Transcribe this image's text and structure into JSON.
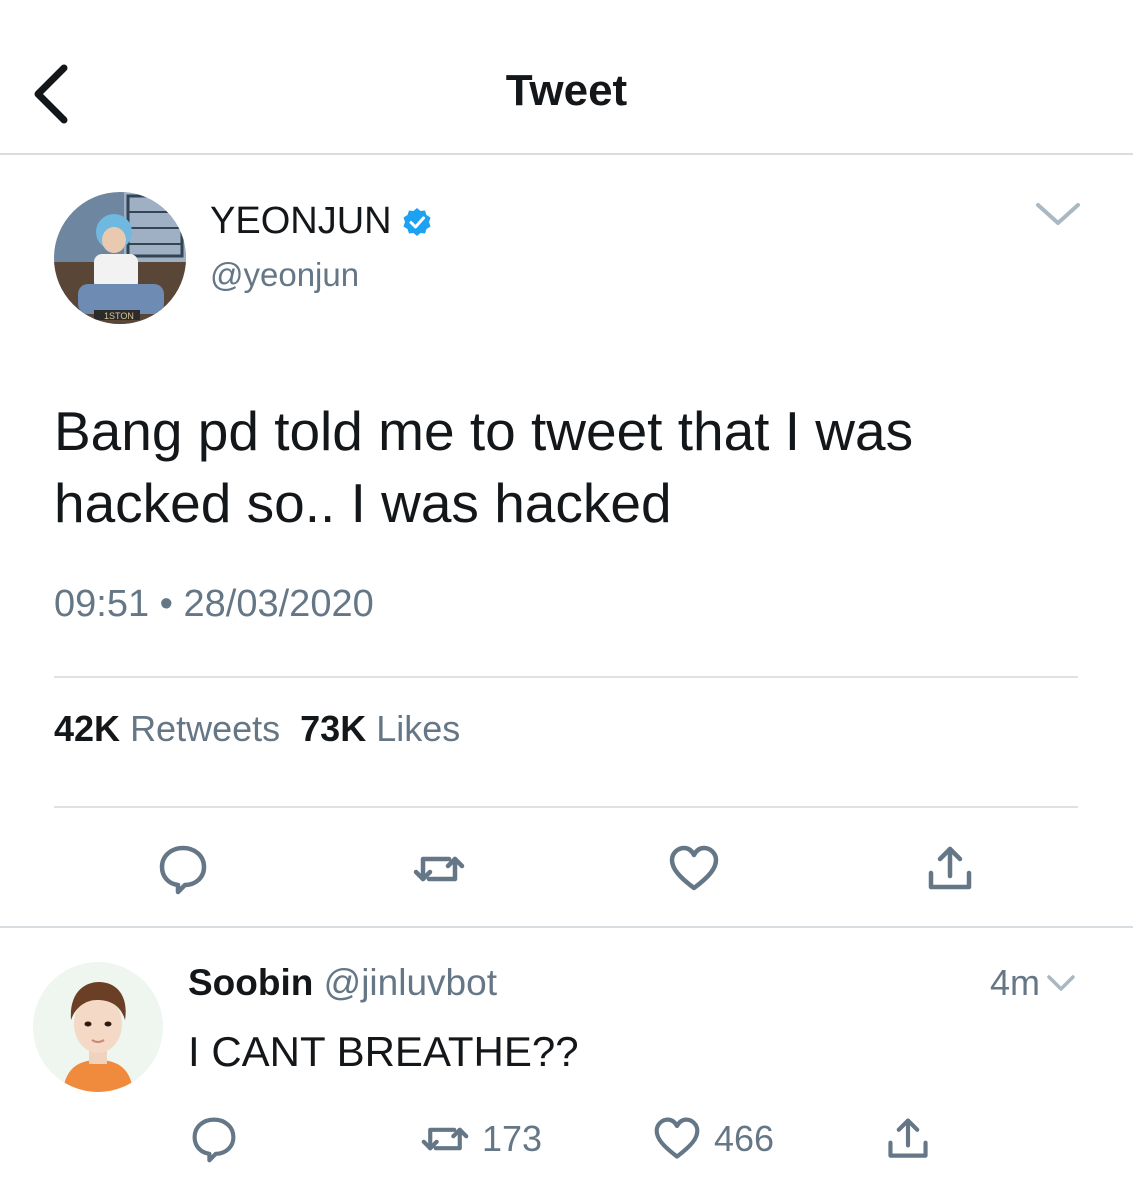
{
  "header": {
    "title": "Tweet",
    "back_icon": "chevron-left-icon"
  },
  "tweet": {
    "name": "YEONJUN",
    "verified_icon": "verified-badge-icon",
    "handle": "@yeonjun",
    "text_line1": "Bang pd told me to tweet that I was",
    "text_line2": "hacked so.. I was hacked",
    "time": "09:51",
    "separator": "•",
    "date": "28/03/2020",
    "retweets_count": "42K",
    "retweets_label": "Retweets",
    "likes_count": "73K",
    "likes_label": "Likes",
    "avatar_text": "1STON"
  },
  "reply": {
    "name": "Soobin",
    "handle": "@jinluvbot",
    "time": "4m",
    "text": "I CANT BREATHE??",
    "retweets": "173",
    "likes": "466"
  },
  "colors": {
    "verified": "#1da1f2",
    "secondary": "#657786",
    "primary": "#14171a",
    "divider": "#dde2e6"
  }
}
